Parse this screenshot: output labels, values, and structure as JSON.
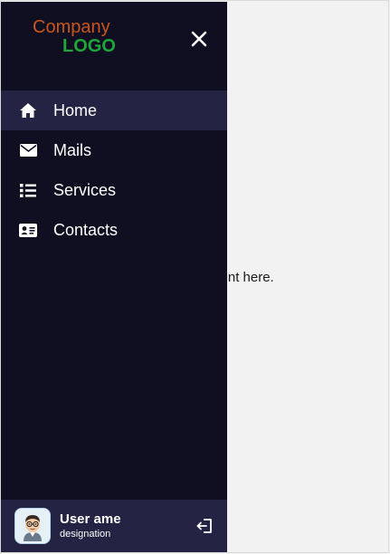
{
  "main": {
    "content_text": "ntent here."
  },
  "sidebar": {
    "logo": {
      "line1": "Company",
      "line2": "LOGO"
    },
    "close_icon": "close-icon",
    "items": [
      {
        "label": "Home",
        "icon": "home-icon",
        "active": true
      },
      {
        "label": "Mails",
        "icon": "envelope-icon",
        "active": false
      },
      {
        "label": "Services",
        "icon": "list-icon",
        "active": false
      },
      {
        "label": "Contacts",
        "icon": "contact-card-icon",
        "active": false
      }
    ],
    "footer": {
      "user_name": "User ame",
      "designation": "designation",
      "logout_icon": "logout-icon"
    }
  },
  "colors": {
    "sidebar_bg": "#100f22",
    "active_item_bg": "#242343",
    "logo_company": "#c9561c",
    "logo_text": "#1fa63a",
    "page_bg": "#f2f2f2"
  }
}
